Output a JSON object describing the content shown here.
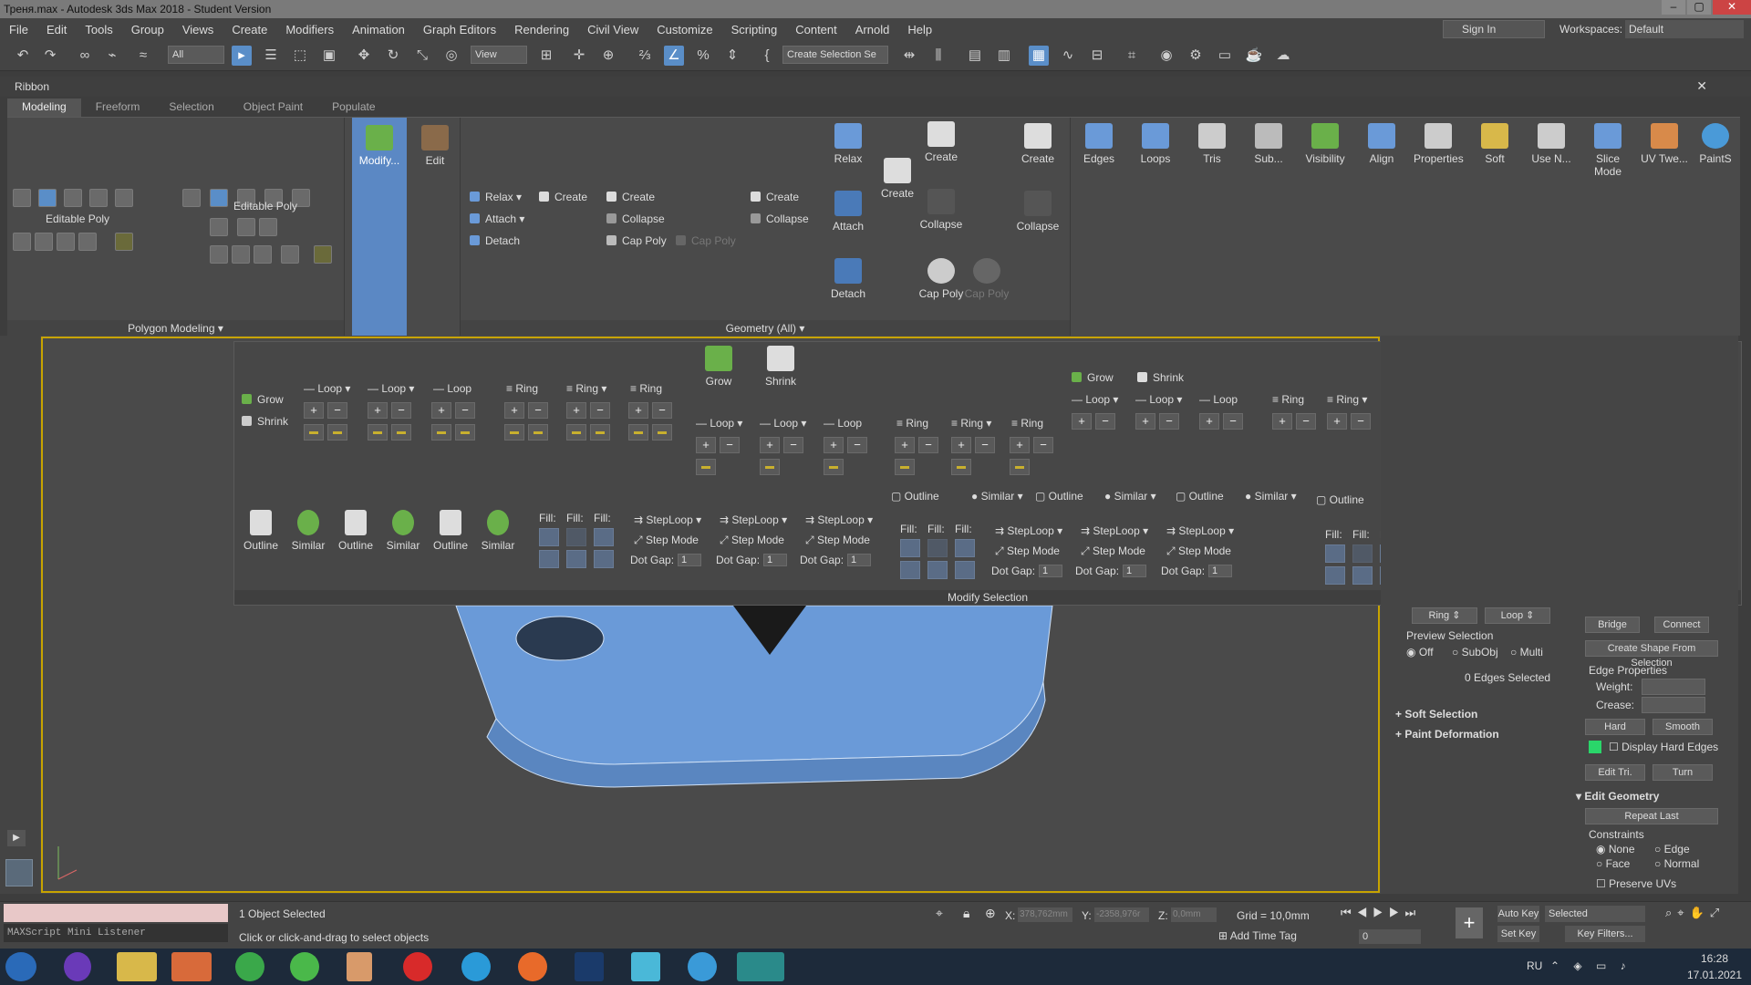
{
  "window": {
    "title": "Треня.max - Autodesk 3ds Max 2018 - Student Version"
  },
  "menu": [
    "File",
    "Edit",
    "Tools",
    "Group",
    "Views",
    "Create",
    "Modifiers",
    "Animation",
    "Graph Editors",
    "Rendering",
    "Civil View",
    "Customize",
    "Scripting",
    "Content",
    "Arnold",
    "Help"
  ],
  "account": {
    "signin": "Sign In",
    "workspaces_label": "Workspaces:",
    "workspace": "Default"
  },
  "toolbar": {
    "filter": "All",
    "view": "View",
    "selection_set": "Create Selection Se"
  },
  "ribbon": {
    "label": "Ribbon",
    "tabs": [
      "Modeling",
      "Freeform",
      "Selection",
      "Object Paint",
      "Populate"
    ],
    "polygon_modeling": {
      "editable_poly_1": "Editable Poly",
      "editable_poly_2": "Editable Poly",
      "footer": "Polygon Modeling"
    },
    "modify": {
      "modify_label": "Modify...",
      "edit_label": "Edit"
    },
    "geometry": {
      "footer": "Geometry (All)",
      "relax": "Relax",
      "attach": "Attach",
      "detach": "Detach",
      "create1": "Create",
      "create2": "Create",
      "collapse1": "Collapse",
      "cap_poly": "Cap Poly",
      "cap_poly2": "Cap Poly",
      "create3": "Create",
      "collapse2": "Collapse",
      "big_relax": "Relax",
      "big_attach": "Attach",
      "big_detach": "Detach",
      "big_create1": "Create",
      "big_create2": "Create",
      "big_collapse1": "Collapse",
      "big_cap_poly": "Cap Poly",
      "big_cap_poly2": "Cap Poly",
      "big_create3": "Create",
      "big_collapse2": "Collapse"
    },
    "right_tools": [
      "Edges",
      "Loops",
      "Tris",
      "Sub...",
      "Visibility",
      "Align",
      "Properties",
      "Soft",
      "Use N...",
      "Slice Mode",
      "UV Twe...",
      "PaintS"
    ]
  },
  "flyout": {
    "footer": "Modify Selection",
    "grow": "Grow",
    "shrink": "Shrink",
    "grow2": "Grow",
    "shrink2": "Shrink",
    "grow3": "Grow",
    "shrink3": "Shrink",
    "loop": "Loop",
    "ring": "Ring",
    "outline": "Outline",
    "similar": "Similar",
    "fill": "Fill:",
    "steploop": "StepLoop",
    "step_mode": "Step Mode",
    "dot_gap": "Dot Gap:",
    "dot_value": "1"
  },
  "command_panel": {
    "ring": "Ring",
    "loop": "Loop",
    "preview_selection": "Preview Selection",
    "off": "Off",
    "subobj": "SubObj",
    "multi": "Multi",
    "edges_selected": "0 Edges Selected",
    "soft_selection": "Soft Selection",
    "paint_deformation": "Paint Deformation",
    "bridge": "Bridge",
    "connect": "Connect",
    "create_shape": "Create Shape From Selection",
    "edge_properties": "Edge Properties",
    "weight": "Weight:",
    "crease": "Crease:",
    "hard": "Hard",
    "smooth": "Smooth",
    "display_hard_edges": "Display Hard Edges",
    "edit_tri": "Edit Tri.",
    "turn": "Turn",
    "edit_geometry": "Edit Geometry",
    "repeat_last": "Repeat Last",
    "constraints": "Constraints",
    "none": "None",
    "edge": "Edge",
    "face": "Face",
    "normal": "Normal",
    "preserve_uvs": "Preserve UVs"
  },
  "status": {
    "listener": "MAXScript Mini Listener",
    "selected": "1 Object Selected",
    "prompt": "Click or click-and-drag to select objects",
    "x_label": "X:",
    "x_value": "378,762mm",
    "y_label": "Y:",
    "y_value": "-2358,976r",
    "z_label": "Z:",
    "z_value": "0,0mm",
    "grid": "Grid = 10,0mm",
    "add_time_tag": "Add Time Tag",
    "auto_key": "Auto Key",
    "set_key": "Set Key",
    "selected_dropdown": "Selected",
    "key_filters": "Key Filters...",
    "frame": "0"
  },
  "taskbar": {
    "lang": "RU",
    "time": "16:28",
    "date": "17.01.2021"
  }
}
